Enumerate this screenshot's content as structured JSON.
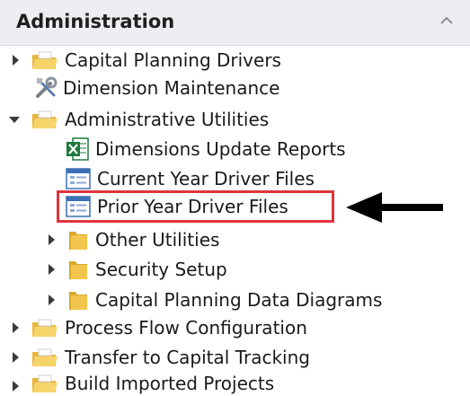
{
  "panel": {
    "title": "Administration",
    "collapse_icon": "chevron-up-icon"
  },
  "tree": {
    "capital_planning_drivers": {
      "label": "Capital Planning Drivers",
      "icon": "folder-open-icon",
      "state": "collapsed"
    },
    "dimension_maintenance": {
      "label": "Dimension Maintenance",
      "icon": "tools-icon"
    },
    "administrative_utilities": {
      "label": "Administrative Utilities",
      "icon": "folder-open-icon",
      "state": "expanded"
    },
    "dimensions_update_reports": {
      "label": "Dimensions Update Reports",
      "icon": "excel-icon"
    },
    "current_year_driver_files": {
      "label": "Current Year Driver Files",
      "icon": "form-icon"
    },
    "prior_year_driver_files": {
      "label": "Prior Year Driver Files",
      "icon": "form-icon",
      "highlighted": true
    },
    "other_utilities": {
      "label": "Other Utilities",
      "icon": "folder-closed-icon",
      "state": "collapsed"
    },
    "security_setup": {
      "label": "Security Setup",
      "icon": "folder-closed-icon",
      "state": "collapsed"
    },
    "capital_planning_data_diagrams": {
      "label": "Capital Planning Data Diagrams",
      "icon": "folder-closed-icon",
      "state": "collapsed"
    },
    "process_flow_configuration": {
      "label": "Process Flow Configuration",
      "icon": "folder-open-icon",
      "state": "collapsed"
    },
    "transfer_to_capital_tracking": {
      "label": "Transfer to Capital Tracking",
      "icon": "folder-open-icon",
      "state": "collapsed"
    },
    "build_imported_projects": {
      "label": "Build Imported Projects",
      "icon": "folder-open-icon",
      "state": "collapsed"
    }
  },
  "colors": {
    "highlight": "#e0333b",
    "folder": "#f2c64c",
    "excel": "#1e7a3c",
    "form": "#3b6fb6"
  }
}
